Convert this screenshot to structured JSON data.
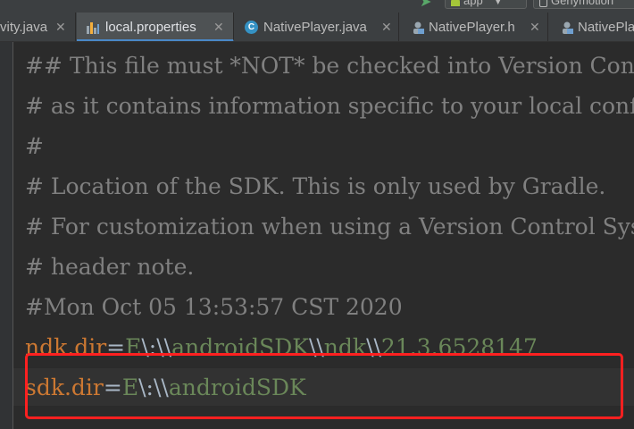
{
  "toolbar": {
    "run_config": "app",
    "device": "Genymotion"
  },
  "tabs": [
    {
      "label": "vity.java",
      "icon": "java-file-icon"
    },
    {
      "label": "local.properties",
      "icon": "properties-file-icon",
      "active": true
    },
    {
      "label": "NativePlayer.java",
      "icon": "class-icon"
    },
    {
      "label": "NativePlayer.h",
      "icon": "header-file-icon"
    },
    {
      "label": "NativePla",
      "icon": "header-file-icon"
    }
  ],
  "code": {
    "lines": [
      "## This file must *NOT* be checked into Version Control Systems,",
      "# as it contains information specific to your local configuration.",
      "#",
      "# Location of the SDK. This is only used by Gradle.",
      "# For customization when using a Version Control System, please read the",
      "# header note.",
      "#Mon Oct 05 13:53:57 CST 2020"
    ],
    "ndk_key": "ndk.dir",
    "ndk_eq": "=",
    "ndk_value_parts": [
      "E",
      "\\:",
      "\\\\",
      "androidSDK",
      "\\\\",
      "ndk",
      "\\\\",
      "21.3.6528147"
    ],
    "sdk_key": "sdk.dir",
    "sdk_eq": "=",
    "sdk_value_parts": [
      "E",
      "\\:",
      "\\\\",
      "androidSDK"
    ]
  },
  "colors": {
    "highlight_box": "#ff2020",
    "active_tab_underline": "#4a88c7"
  }
}
